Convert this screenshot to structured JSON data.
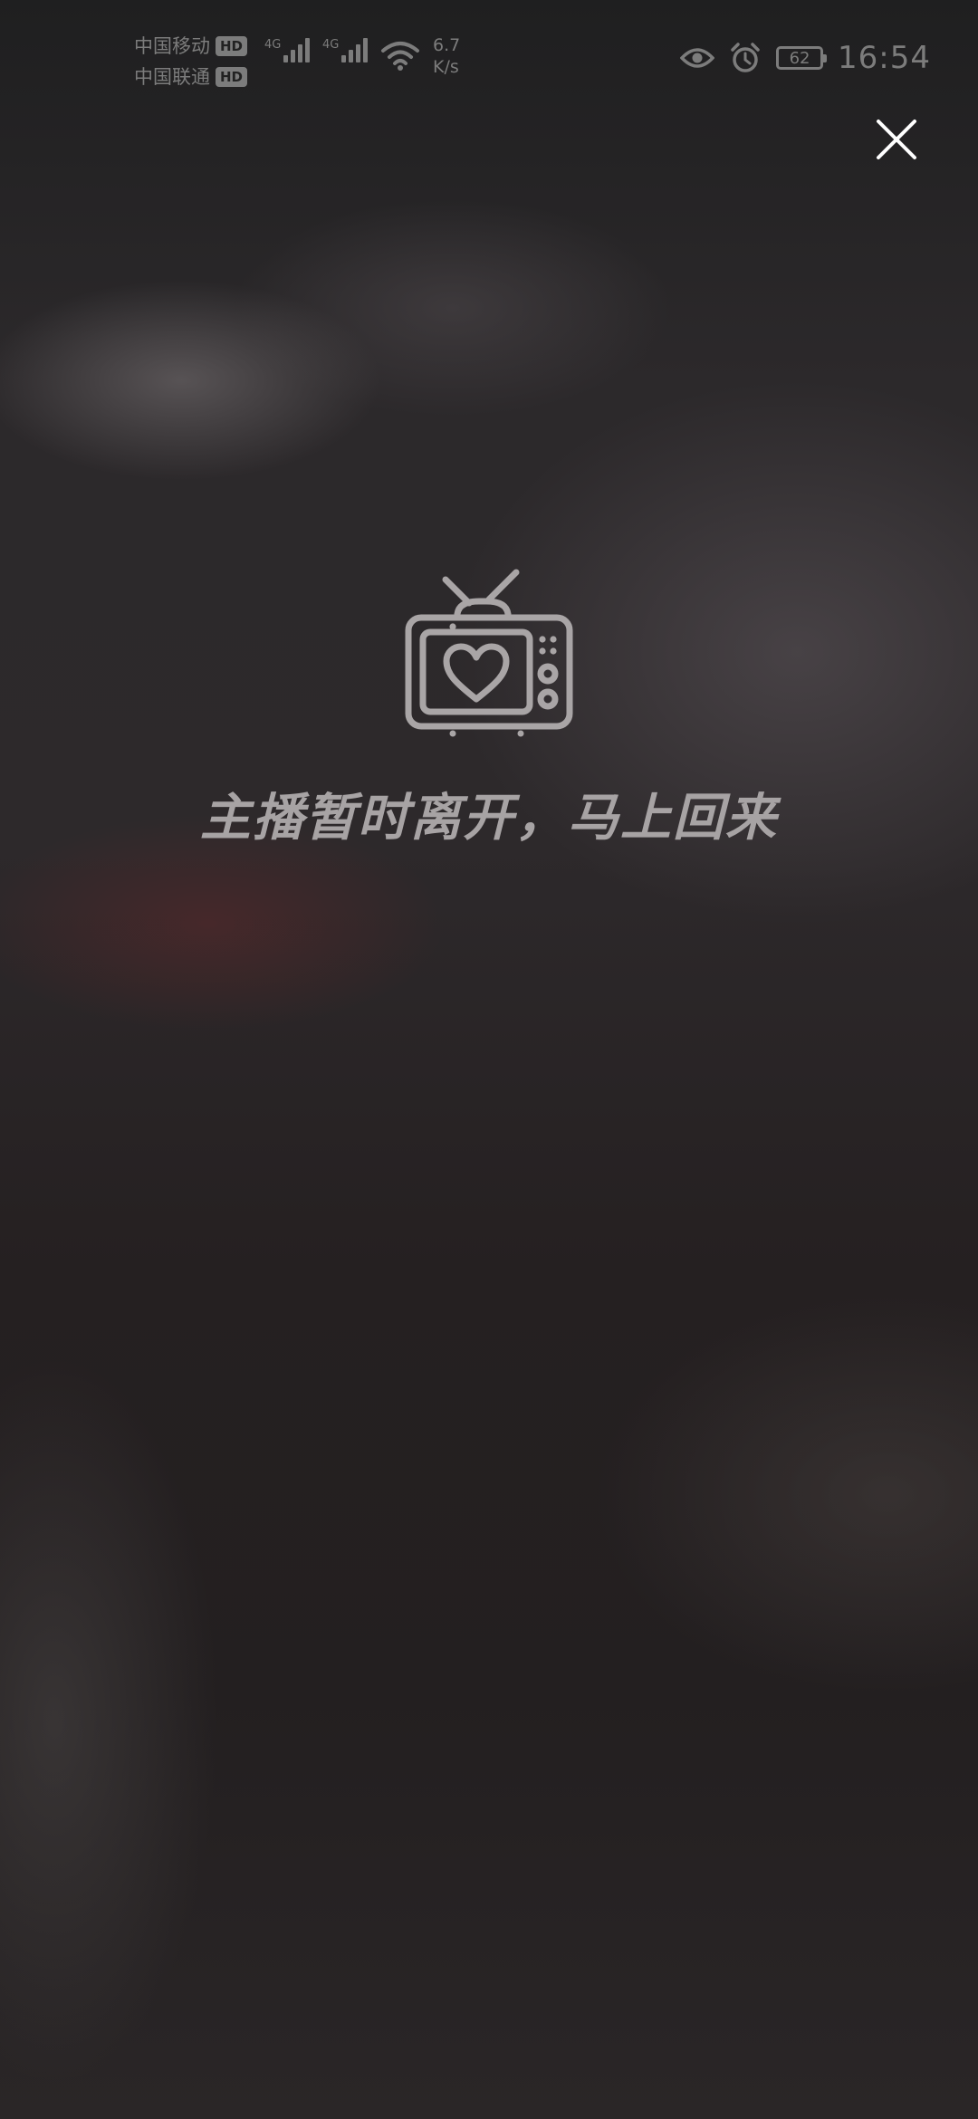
{
  "status_bar": {
    "carrier_1": "中国移动",
    "carrier_2": "中国联通",
    "hd_label": "HD",
    "network_type_1": "4G",
    "network_type_2": "4G",
    "speed_value": "6.7",
    "speed_unit": "K/s",
    "battery_level": "62",
    "time": "16:54",
    "icons": [
      "signal-icon",
      "wifi-icon",
      "eye-icon",
      "alarm-icon",
      "battery-icon"
    ]
  },
  "close": {
    "icon": "close-icon"
  },
  "live_status": {
    "icon": "tv-heart-icon",
    "message": "主播暂时离开，马上回来"
  },
  "colors": {
    "background": "#242122",
    "status_text": "#7c7c7c",
    "message_text": "#a7a3a4",
    "icon_stroke": "#a9a5a6",
    "close_icon": "#ffffff"
  }
}
